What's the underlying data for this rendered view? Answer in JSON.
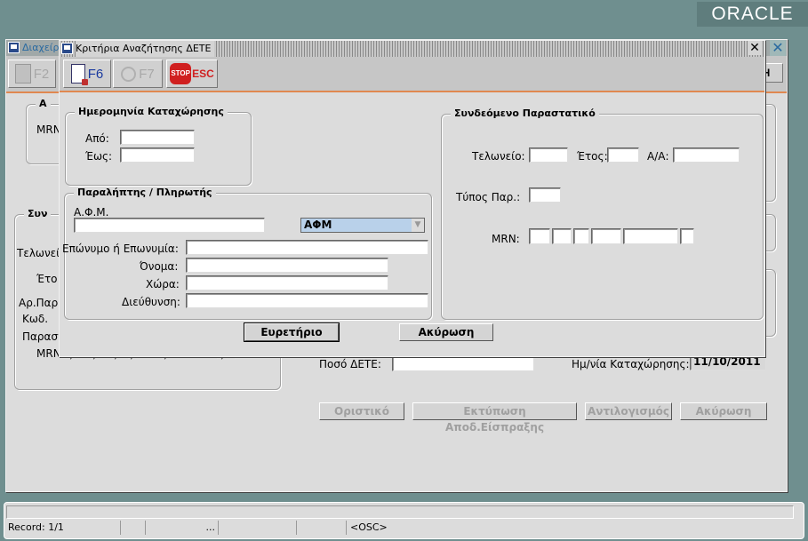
{
  "oracle_logo": "ORACLE",
  "back_window": {
    "title": "Διαχείρ",
    "toolbar_right_label": "Η",
    "left_top_frame_title": "Α",
    "left_top_mrn": "MRN",
    "left_frame_title": "Συν",
    "labels": [
      "Τελωνείο",
      "Έτο",
      "Αρ.Παρ",
      "Κωδ.",
      "Παραστ",
      "MRN"
    ],
    "poso_dete_label": "Ποσό ΔΕΤΕ:",
    "date_label": "Ημ/νία Καταχώρησης:",
    "date_value": "11/10/2011",
    "buttons": {
      "oristiko": "Οριστικό",
      "ektyposi": "Εκτύπωση Αποδ.Είσπραξης",
      "antilogismos": "Αντιλογισμός",
      "akyrosi": "Ακύρωση"
    }
  },
  "dialog": {
    "title": "Κριτήρια Αναζήτησης ΔΕΤΕ",
    "toolbar": {
      "f2": "F2",
      "f6": "F6",
      "f7": "F7",
      "stop": "STOP",
      "esc": "ESC"
    },
    "date_frame": {
      "title": "Ημερομηνία Καταχώρησης",
      "from_label": "Από:",
      "to_label": "Έως:",
      "from_value": "",
      "to_value": ""
    },
    "receiver_frame": {
      "title": "Παραλήπτης / Πληρωτής",
      "afm_label": "Α.Φ.Μ.",
      "afm_value": "",
      "afm_select": "ΑΦΜ",
      "surname_label": "Επώνυμο ή Επωνυμία:",
      "name_label": "Όνομα:",
      "country_label": "Χώρα:",
      "address_label": "Διεύθυνση:"
    },
    "related_frame": {
      "title": "Συνδεόμενο Παραστατικό",
      "customs_label": "Τελωνείο:",
      "year_label": "Έτος:",
      "aa_label": "Α/Α:",
      "type_label": "Τύπος Παρ.:",
      "mrn_label": "MRN:"
    },
    "buttons": {
      "search": "Ευρετήριο",
      "cancel": "Ακύρωση"
    }
  },
  "status_bar": {
    "record": "Record: 1/1",
    "dots": "...",
    "osc": "<OSC>"
  }
}
